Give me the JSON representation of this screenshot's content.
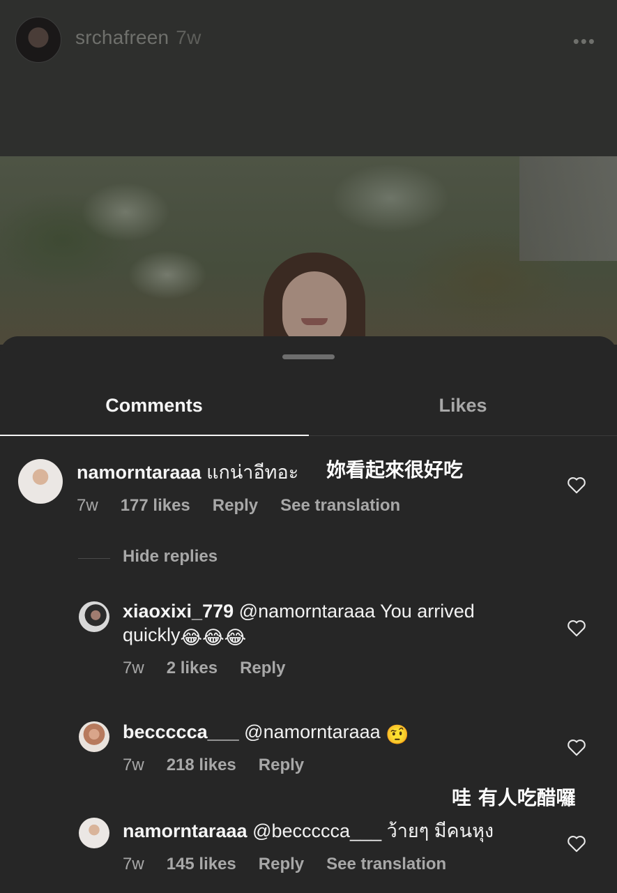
{
  "post": {
    "username": "srchafreen",
    "age": "7w",
    "more_icon": "more-horizontal-icon"
  },
  "tabs": [
    {
      "label": "Comments",
      "active": true
    },
    {
      "label": "Likes",
      "active": false
    }
  ],
  "comments": [
    {
      "username": "namorntaraaa",
      "text": "แกน่าอีทอะ",
      "overlay": "妳看起來很好吃",
      "age": "7w",
      "likes": "177 likes",
      "reply": "Reply",
      "translate": "See translation"
    }
  ],
  "hide_replies": "Hide replies",
  "replies": [
    {
      "username": "xiaoxixi_779",
      "text_line1": "@namorntaraaa You arrived",
      "text_line2": "quickly",
      "emoji": "😂😂😂",
      "age": "7w",
      "likes": "2 likes",
      "reply": "Reply"
    },
    {
      "username": "beccccca___",
      "text": "@namorntaraaa",
      "emoji": "🤨",
      "age": "7w",
      "likes": "218 likes",
      "reply": "Reply"
    },
    {
      "username": "namorntaraaa",
      "text": "@beccccca___ ว้ายๆ มีคนหุง",
      "overlay": "哇 有人吃醋囉",
      "age": "7w",
      "likes": "145 likes",
      "reply": "Reply",
      "translate": "See translation"
    }
  ],
  "colors": {
    "background": "#262626",
    "text": "#f2f2f2",
    "muted": "#a8a8a8"
  }
}
